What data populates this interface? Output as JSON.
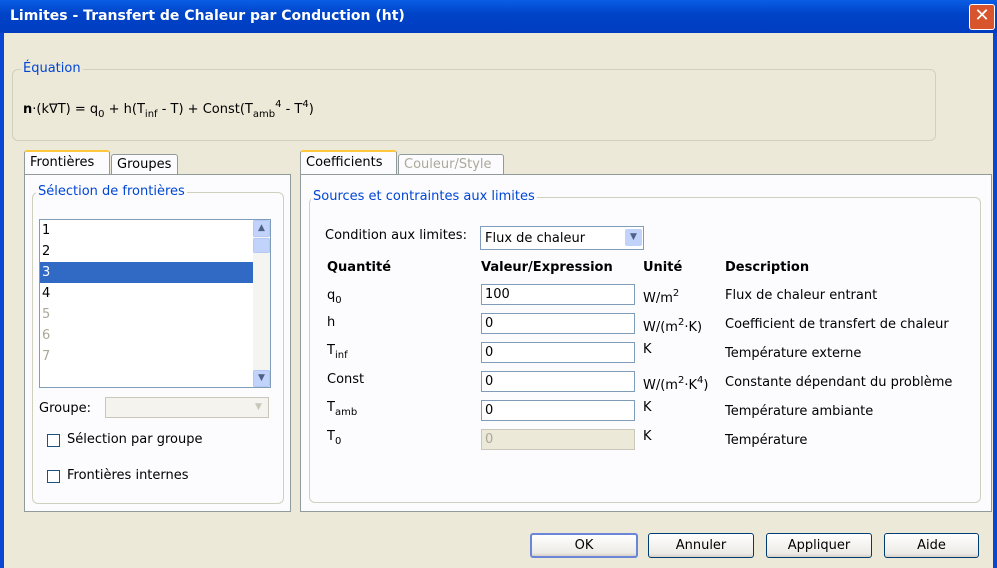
{
  "window": {
    "title": "Limites - Transfert de Chaleur par Conduction (ht)"
  },
  "equation": {
    "legend": "Équation",
    "bold_n": "n",
    "part1": "·(k∇T) = q",
    "sub0": "0",
    "part2": " + h(T",
    "sub_inf": "inf",
    "part3": " - T) + Const(T",
    "sub_amb": "amb",
    "sup4a": "4",
    "part4": " - T",
    "sup4b": "4",
    "part5": ")"
  },
  "left_tabs": [
    {
      "label": "Frontières"
    },
    {
      "label": "Groupes"
    }
  ],
  "boundary_selection": {
    "legend": "Sélection de frontières",
    "items": [
      "1",
      "2",
      "3",
      "4",
      "5",
      "6",
      "7"
    ],
    "selected": "3",
    "group_label": "Groupe:",
    "group_value": "",
    "select_by_group": "Sélection par groupe",
    "internal_boundaries": "Frontières internes"
  },
  "right_tabs": [
    {
      "label": "Coefficients"
    },
    {
      "label": "Couleur/Style"
    }
  ],
  "sources": {
    "legend": "Sources et contraintes aux limites",
    "condition_label": "Condition aux limites:",
    "condition_value": "Flux de chaleur",
    "headers": {
      "quantity": "Quantité",
      "value": "Valeur/Expression",
      "unit": "Unité",
      "description": "Description"
    },
    "rows": [
      {
        "q": "q",
        "q_sub": "0",
        "value": "100",
        "unit": "W/m",
        "unit_sup": "2",
        "unit_end": "",
        "description": "Flux de chaleur entrant"
      },
      {
        "q": "h",
        "q_sub": "",
        "value": "0",
        "unit": "W/(m",
        "unit_sup": "2",
        "unit_end": "·K)",
        "description": "Coefficient de transfert de chaleur"
      },
      {
        "q": "T",
        "q_sub": "inf",
        "value": "0",
        "unit": "K",
        "unit_sup": "",
        "unit_end": "",
        "description": "Température externe"
      },
      {
        "q": "Const",
        "q_sub": "",
        "value": "0",
        "unit": "W/(m",
        "unit_sup": "2",
        "unit_end": "·K",
        "unit_sup2": "4",
        "unit_end2": ")",
        "description": "Constante dépendant du problème"
      },
      {
        "q": "T",
        "q_sub": "amb",
        "value": "0",
        "unit": "K",
        "unit_sup": "",
        "unit_end": "",
        "description": "Température ambiante"
      },
      {
        "q": "T",
        "q_sub": "0",
        "value": "0",
        "unit": "K",
        "unit_sup": "",
        "unit_end": "",
        "description": "Température"
      }
    ]
  },
  "buttons": {
    "ok": "OK",
    "cancel": "Annuler",
    "apply": "Appliquer",
    "help": "Aide"
  },
  "icons": {
    "close": "close-icon",
    "scroll_up": "chevron-up-icon",
    "scroll_down": "chevron-down-icon",
    "dropdown": "chevron-down-icon"
  },
  "colors": {
    "titlebar": "#0044c8",
    "selection": "#316ac5",
    "legend": "#0046d5",
    "face": "#ece9d8"
  }
}
